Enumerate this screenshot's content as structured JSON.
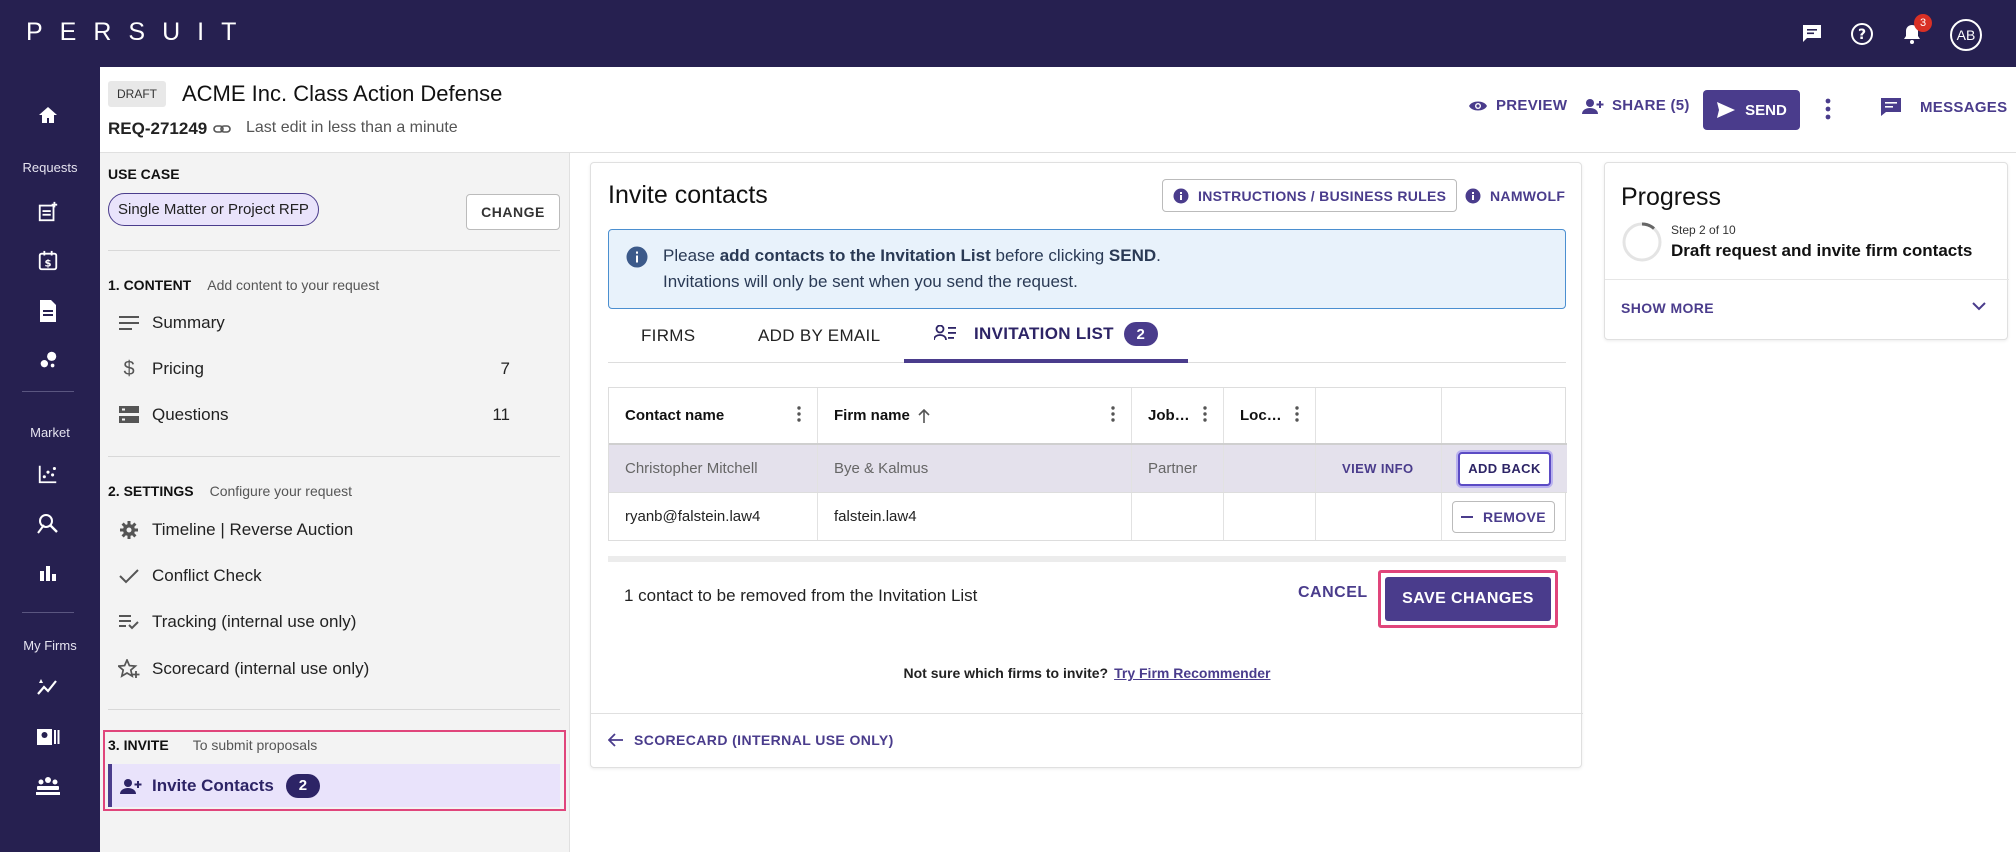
{
  "app": {
    "logo_text": "PERSUIT",
    "notifications_count": "3",
    "avatar_initials": "AB"
  },
  "rail": {
    "section_requests": "Requests",
    "section_market": "Market",
    "section_my_firms": "My Firms"
  },
  "header": {
    "status_badge": "DRAFT",
    "title": "ACME Inc. Class Action Defense",
    "request_id": "REQ-271249",
    "last_edit": "Last edit in less than a minute",
    "preview_label": "PREVIEW",
    "share_label": "SHARE (5)",
    "send_label": "SEND",
    "messages_label": "MESSAGES"
  },
  "nav": {
    "use_case_heading": "USE CASE",
    "use_case_value": "Single Matter or Project RFP",
    "change_label": "CHANGE",
    "content_heading": "1. CONTENT",
    "content_sub": "Add content to your request",
    "content_items": [
      {
        "label": "Summary",
        "count": ""
      },
      {
        "label": "Pricing",
        "count": "7"
      },
      {
        "label": "Questions",
        "count": "11"
      }
    ],
    "settings_heading": "2. SETTINGS",
    "settings_sub": "Configure your request",
    "settings_items": [
      {
        "label": "Timeline | Reverse Auction"
      },
      {
        "label": "Conflict Check"
      },
      {
        "label": "Tracking (internal use only)"
      },
      {
        "label": "Scorecard (internal use only)"
      }
    ],
    "invite_heading": "3. INVITE",
    "invite_sub": "To submit proposals",
    "invite_item_label": "Invite Contacts",
    "invite_item_count": "2"
  },
  "main": {
    "title": "Invite contacts",
    "instructions_label": "INSTRUCTIONS / BUSINESS RULES",
    "namwolf_label": "NAMWOLF",
    "info_pre": "Please ",
    "info_bold1": "add contacts to the Invitation List",
    "info_mid": " before clicking ",
    "info_bold2": "SEND",
    "info_end": ".",
    "info_line2": "Invitations will only be sent when you send the request.",
    "tabs": [
      {
        "label": "FIRMS"
      },
      {
        "label": "ADD BY EMAIL"
      },
      {
        "label": "INVITATION LIST",
        "count": "2"
      }
    ],
    "table": {
      "headers": [
        "Contact name",
        "Firm name",
        "Job…",
        "Loc…"
      ],
      "rows": [
        {
          "contact": "Christopher Mitchell",
          "firm": "Bye & Kalmus",
          "job": "Partner",
          "location": "",
          "info_action": "VIEW INFO",
          "action": "ADD BACK"
        },
        {
          "contact": "ryanb@falstein.law4",
          "firm": "falstein.law4",
          "job": "",
          "location": "",
          "info_action": "",
          "action": "REMOVE"
        }
      ]
    },
    "footer_message": "1 contact to be removed from the Invitation List",
    "cancel_label": "CANCEL",
    "save_label": "SAVE CHANGES",
    "recommend_text": "Not sure which firms to invite?",
    "recommend_link": "Try Firm Recommender",
    "back_label": "SCORECARD (INTERNAL USE ONLY)"
  },
  "progress": {
    "title": "Progress",
    "step_label": "Step 2 of 10",
    "step_name": "Draft request and invite firm contacts",
    "show_more_label": "SHOW MORE"
  },
  "colors": {
    "brand_dark": "#262050",
    "accent": "#4a3c8c",
    "highlight_border": "#e0457b"
  }
}
